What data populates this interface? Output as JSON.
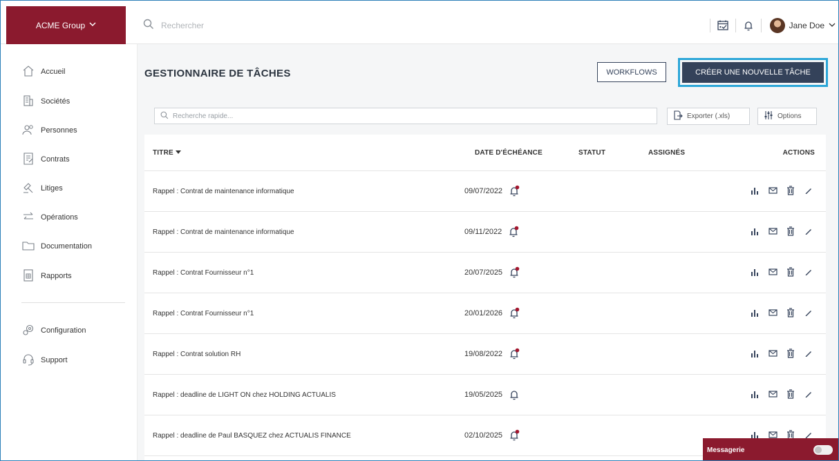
{
  "brand": {
    "name": "ACME Group",
    "chevron_icon": "chevron-down-icon"
  },
  "search": {
    "placeholder": "Rechercher",
    "icon": "search-icon"
  },
  "header": {
    "calendar_icon": "calendar-icon",
    "bell_icon": "bell-icon",
    "user_name": "Jane Doe",
    "user_chevron": "chevron-down-icon"
  },
  "sidebar": {
    "items": [
      {
        "label": "Accueil",
        "icon": "home-icon"
      },
      {
        "label": "Sociétés",
        "icon": "building-icon"
      },
      {
        "label": "Personnes",
        "icon": "people-icon"
      },
      {
        "label": "Contrats",
        "icon": "contract-icon"
      },
      {
        "label": "Litiges",
        "icon": "gavel-icon"
      },
      {
        "label": "Opérations",
        "icon": "transfer-icon"
      },
      {
        "label": "Documentation",
        "icon": "folder-icon"
      },
      {
        "label": "Rapports",
        "icon": "report-icon"
      }
    ],
    "bottom_items": [
      {
        "label": "Configuration",
        "icon": "gears-icon"
      },
      {
        "label": "Support",
        "icon": "headset-icon"
      }
    ]
  },
  "page": {
    "title": "GESTIONNAIRE DE TÂCHES",
    "workflows_label": "WORKFLOWS",
    "create_label": "CRÉER UNE NOUVELLE TÂCHE"
  },
  "toolbar": {
    "quick_search_placeholder": "Recherche rapide...",
    "export_label": "Exporter (.xls)",
    "options_label": "Options"
  },
  "table": {
    "columns": {
      "title": "TITRE",
      "due_date": "DATE D'ÉCHÉANCE",
      "status": "STATUT",
      "assignees": "ASSIGNÉS",
      "actions": "ACTIONS"
    },
    "sort_icon": "caret-down-icon",
    "rows": [
      {
        "title": "Rappel : Contrat de maintenance informatique",
        "date": "09/07/2022",
        "alert": true
      },
      {
        "title": "Rappel : Contrat de maintenance informatique",
        "date": "09/11/2022",
        "alert": true
      },
      {
        "title": "Rappel : Contrat Fournisseur n°1",
        "date": "20/07/2025",
        "alert": true
      },
      {
        "title": "Rappel : Contrat Fournisseur n°1",
        "date": "20/01/2026",
        "alert": true
      },
      {
        "title": "Rappel : Contrat solution RH",
        "date": "19/08/2022",
        "alert": true
      },
      {
        "title": "Rappel : deadline de LIGHT ON chez HOLDING ACTUALIS",
        "date": "19/05/2025",
        "alert": false
      },
      {
        "title": "Rappel : deadline de Paul BASQUEZ chez ACTUALIS FINANCE",
        "date": "02/10/2025",
        "alert": true
      }
    ]
  },
  "messaging": {
    "label": "Messagerie",
    "enabled": false
  },
  "colors": {
    "brand": "#8b1a2e",
    "primary": "#34425a",
    "highlight": "#2aa6d8"
  }
}
